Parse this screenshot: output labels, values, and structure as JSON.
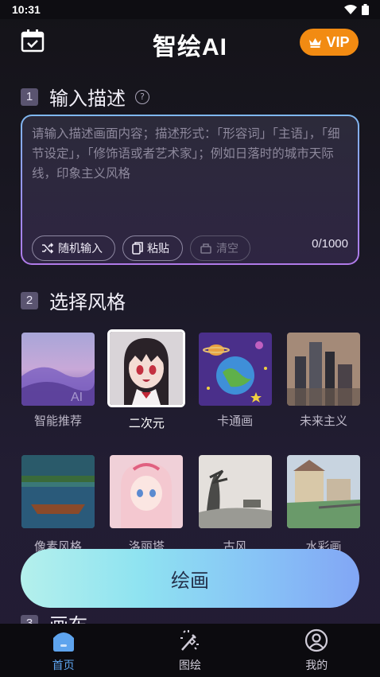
{
  "status_bar": {
    "time": "10:31"
  },
  "header": {
    "title": "智绘AI",
    "vip_label": "VIP"
  },
  "section1": {
    "number": "1",
    "title": "输入描述",
    "placeholder": "请输入描述画面内容；描述形式：「形容词」「主语」，「细节设定」，「修饰语或者艺术家」；例如日落时的城市天际线，印象主义风格",
    "random_label": "随机输入",
    "paste_label": "粘贴",
    "clear_label": "清空",
    "counter": "0/1000"
  },
  "section2": {
    "number": "2",
    "title": "选择风格",
    "styles": [
      {
        "label": "智能推荐",
        "selected": false
      },
      {
        "label": "二次元",
        "selected": true
      },
      {
        "label": "卡通画",
        "selected": false
      },
      {
        "label": "未来主义",
        "selected": false
      },
      {
        "label": "像素风格",
        "selected": false
      },
      {
        "label": "洛丽塔",
        "selected": false
      },
      {
        "label": "古风",
        "selected": false
      },
      {
        "label": "水彩画",
        "selected": false
      }
    ]
  },
  "section3": {
    "number": "3",
    "title": "画布"
  },
  "draw_button": {
    "label": "绘画"
  },
  "bottom_nav": {
    "items": [
      {
        "label": "首页",
        "icon": "home-icon",
        "active": true
      },
      {
        "label": "图绘",
        "icon": "magic-wand-icon",
        "active": false
      },
      {
        "label": "我的",
        "icon": "user-icon",
        "active": false
      }
    ]
  },
  "colors": {
    "accent": "#f28b12",
    "active_nav": "#5ea4ee"
  }
}
